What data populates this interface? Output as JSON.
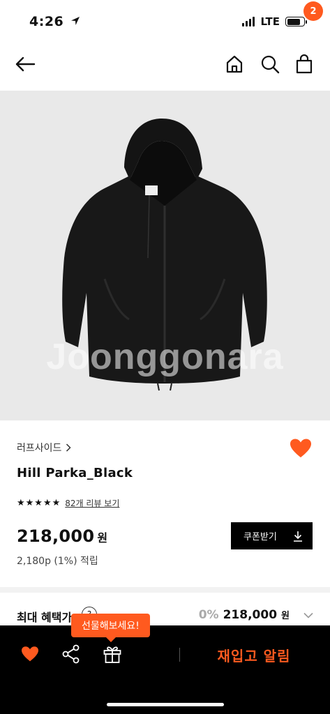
{
  "status_bar": {
    "time": "4:26",
    "network": "LTE"
  },
  "header": {
    "cart_count": "2",
    "icons": [
      "back-arrow-icon",
      "home-icon",
      "search-icon",
      "shopping-bag-icon"
    ]
  },
  "product": {
    "watermark": "Joonggonara",
    "brand": "러프사이드",
    "name": "Hill Parka_Black",
    "rating": 4.5,
    "stars": "★★★★★",
    "review_link": "82개 리뷰 보기",
    "price": "218,000",
    "price_unit": "원",
    "points": "2,180p (1%) 적립",
    "coupon_button": "쿠폰받기"
  },
  "max_benefit": {
    "label": "최대 혜택가",
    "help": "?",
    "discount": "0%",
    "price": "218,000",
    "unit": "원"
  },
  "bottom_bar": {
    "gift_tooltip": "선물해보세요!",
    "restock_button": "재입고 알림"
  },
  "colors": {
    "accent": "#ff5a1f",
    "image_bg": "#e9e9e9",
    "bottom_bar": "#000000"
  }
}
